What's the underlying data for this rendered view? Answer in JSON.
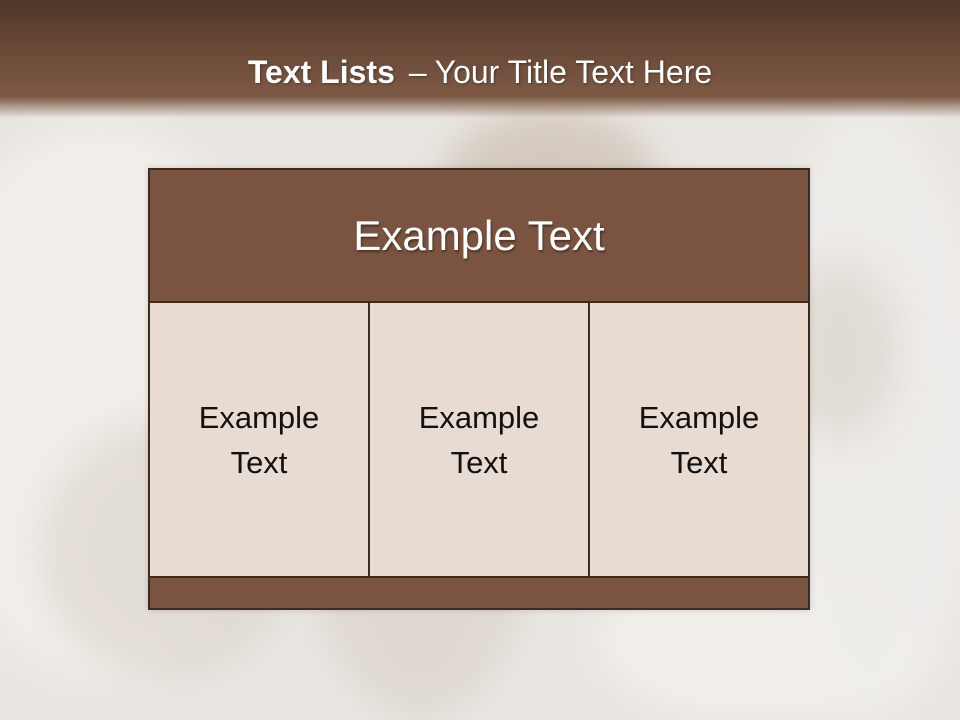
{
  "slide": {
    "title_bold": "Text Lists",
    "title_dash": "–",
    "title_rest": "Your Title Text Here"
  },
  "diagram": {
    "header": "Example Text",
    "cells": [
      "Example Text",
      "Example Text",
      "Example Text"
    ]
  },
  "colors": {
    "header_bar": "#6b4a38",
    "box_fill": "#7a5440",
    "cell_fill": "#e8dbd2",
    "border": "#3f2a20"
  }
}
